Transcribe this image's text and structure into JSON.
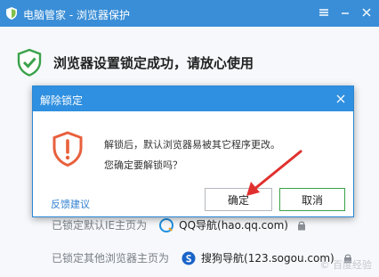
{
  "window": {
    "title": "电脑管家 - 浏览器保护",
    "success_message": "浏览器设置锁定成功，请放心使用"
  },
  "locked_homepages": [
    {
      "label": "已锁定默认IE主页为",
      "site": "QQ导航(hao.qq.com)"
    },
    {
      "label": "已锁定其他浏览器主页为",
      "site": "搜狗导航(123.sogou.com)"
    }
  ],
  "dialog": {
    "title": "解除锁定",
    "message_line1": "解锁后，默认浏览器易被其它程序更改。",
    "message_line2": "您确定要解锁吗？",
    "feedback_link": "反馈建议",
    "confirm_label": "确定",
    "cancel_label": "取消"
  },
  "watermark": "© 百度经验",
  "colors": {
    "titlebar": "#3a8ed7",
    "dialog_title": "#2f8fe0",
    "warning": "#e8603c",
    "success": "#3aa24a",
    "arrow": "#e0302e"
  }
}
